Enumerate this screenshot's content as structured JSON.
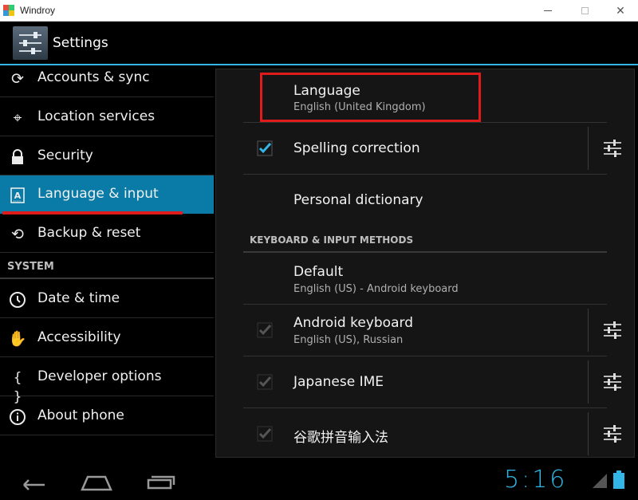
{
  "window": {
    "title": "Windroy",
    "colors": [
      "#e74c3c",
      "#2ecc71",
      "#3498db",
      "#f1c40f"
    ]
  },
  "actionbar": {
    "title": "Settings",
    "icon": "settings-sliders-icon"
  },
  "sidebar": {
    "items": [
      {
        "label": "Accounts & sync",
        "icon": "sync-icon"
      },
      {
        "label": "Location services",
        "icon": "location-icon"
      },
      {
        "label": "Security",
        "icon": "lock-icon"
      },
      {
        "label": "Language & input",
        "icon": "language-icon",
        "selected": true
      },
      {
        "label": "Backup & reset",
        "icon": "backup-icon"
      }
    ],
    "system_header": "SYSTEM",
    "system_items": [
      {
        "label": "Date & time",
        "icon": "clock-icon"
      },
      {
        "label": "Accessibility",
        "icon": "hand-icon"
      },
      {
        "label": "Developer options",
        "icon": "braces-icon"
      },
      {
        "label": "About phone",
        "icon": "info-icon"
      }
    ]
  },
  "main": {
    "language": {
      "title": "Language",
      "summary": "English (United Kingdom)"
    },
    "spelling": {
      "title": "Spelling correction",
      "checked": true
    },
    "dictionary": {
      "title": "Personal dictionary"
    },
    "keyboard_header": "KEYBOARD & INPUT METHODS",
    "default": {
      "title": "Default",
      "summary": "English (US) - Android keyboard"
    },
    "methods": [
      {
        "title": "Android keyboard",
        "summary": "English (US), Russian",
        "checked": true
      },
      {
        "title": "Japanese IME",
        "summary": "",
        "checked": true
      },
      {
        "title": "谷歌拼音输入法",
        "summary": "",
        "checked": true
      }
    ]
  },
  "statusbar": {
    "time": "5:16",
    "accent": "#33b5e5"
  },
  "highlight_color": "#e01b1b"
}
